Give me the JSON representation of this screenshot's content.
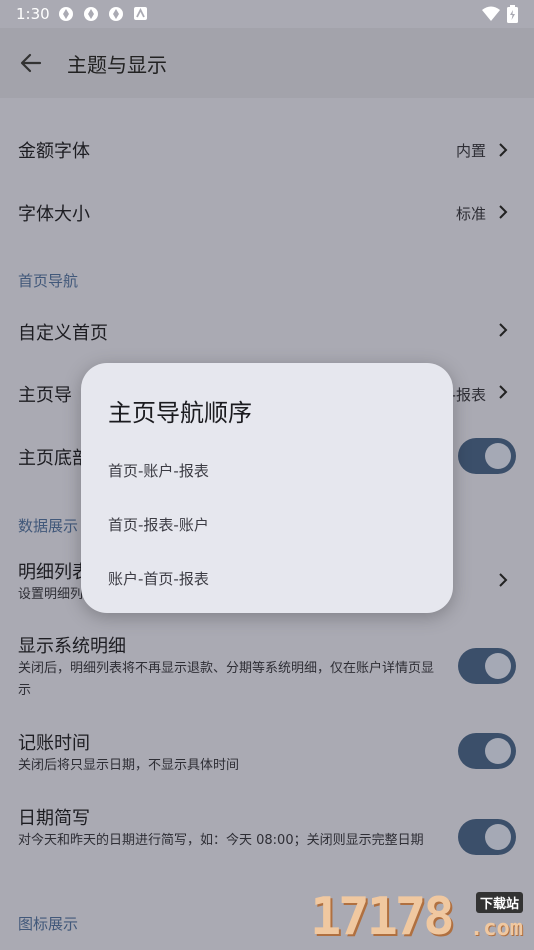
{
  "status_bar": {
    "time": "1:30"
  },
  "header": {
    "title": "主题与显示"
  },
  "settings": {
    "amount_font": {
      "label": "金额字体",
      "value": "内置"
    },
    "font_size": {
      "label": "字体大小",
      "value": "标准"
    },
    "section_home_nav": "首页导航",
    "custom_home": {
      "label": "自定义首页"
    },
    "main_nav": {
      "label": "主页导",
      "value": "-报表"
    },
    "bottom_nav": {
      "label": "主页底部"
    },
    "section_data_display": "数据展示",
    "detail_list": {
      "label": "明细列表",
      "sub": "设置明细列"
    },
    "show_system_detail": {
      "label": "显示系统明细",
      "sub": "关闭后，明细列表将不再显示退款、分期等系统明细，仅在账户详情页显示"
    },
    "record_time": {
      "label": "记账时间",
      "sub": "关闭后将只显示日期，不显示具体时间"
    },
    "date_short": {
      "label": "日期简写",
      "sub": "对今天和昨天的日期进行简写，如：今天 08:00；关闭则显示完整日期"
    },
    "section_icon_display": "图标展示"
  },
  "dialog": {
    "title": "主页导航顺序",
    "options": [
      "首页-账户-报表",
      "首页-报表-账户",
      "账户-首页-报表"
    ]
  },
  "watermark": {
    "main": "17178",
    "tag": "下载站",
    "suffix": ".com"
  },
  "colors": {
    "accent": "#3b4f6a",
    "section": "#41587a",
    "dialog_bg": "#e6e7ee",
    "scrim_bg": "#aaaab3"
  }
}
